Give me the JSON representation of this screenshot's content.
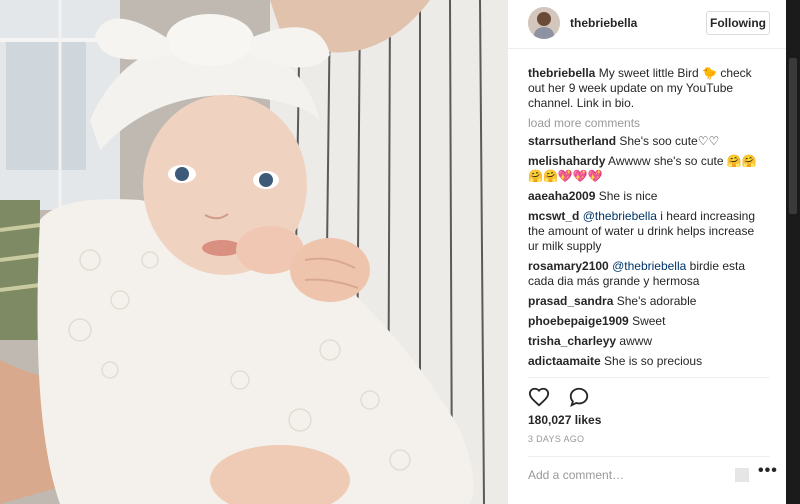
{
  "post": {
    "username": "thebriebella",
    "follow_label": "Following",
    "caption_user": "thebriebella",
    "caption_text": "My sweet little Bird 🐤 check out her 9 week update on my YouTube channel. Link in bio.",
    "load_more": "load more comments",
    "comments": [
      {
        "user": "starrsutherland",
        "mention": "",
        "text": "She's soo cute♡♡"
      },
      {
        "user": "melishahardy",
        "mention": "",
        "text": "Awwww she's so cute 🤗🤗🤗🤗💖💖💖"
      },
      {
        "user": "aaeaha2009",
        "mention": "",
        "text": "She is nice"
      },
      {
        "user": "mcswt_d",
        "mention": "@thebriebella",
        "text": "i heard increasing the amount of water u drink helps increase ur milk supply"
      },
      {
        "user": "rosamary2100",
        "mention": "@thebriebella",
        "text": "birdie esta cada dia más grande y hermosa"
      },
      {
        "user": "prasad_sandra",
        "mention": "",
        "text": "She's adorable"
      },
      {
        "user": "phoebepaige1909",
        "mention": "",
        "text": "Sweet"
      },
      {
        "user": "trisha_charleyy",
        "mention": "",
        "text": "awww"
      },
      {
        "user": "adictaamaite",
        "mention": "",
        "text": "She is so precious"
      }
    ],
    "likes": "180,027 likes",
    "time_ago": "3 DAYS AGO",
    "add_comment_placeholder": "Add a comment…",
    "more_label": "•••"
  },
  "icons": {
    "like": "heart-icon",
    "comment": "speech-bubble-icon",
    "options": "ellipsis-icon"
  },
  "colors": {
    "text": "#262626",
    "muted": "#999999",
    "link": "#003569",
    "backdrop": "#1b1b1b"
  }
}
